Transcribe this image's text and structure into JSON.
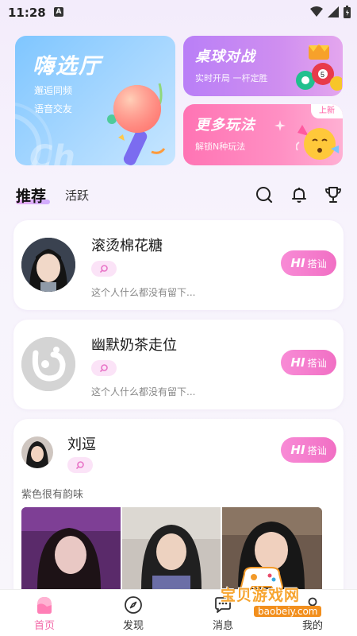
{
  "status_bar": {
    "time": "11:28",
    "notif_letter": "A"
  },
  "banners": {
    "big": {
      "title": "嗨选厅",
      "line1": "邂逅同频",
      "line2": "语音交友",
      "ghost": "Ch"
    },
    "r1": {
      "title": "桌球对战",
      "subtitle": "实时开局 一杆定胜"
    },
    "r2": {
      "title": "更多玩法",
      "subtitle": "解锁N种玩法",
      "badge": "上新"
    }
  },
  "tabs": {
    "main": "推荐",
    "second": "活跃"
  },
  "icons": {
    "search": "search-icon",
    "bell": "bell-icon",
    "trophy": "trophy-icon"
  },
  "users": [
    {
      "name": "滚烫棉花糖",
      "bio": "这个人什么都没有留下...",
      "hi": "HI",
      "hi_label": "搭讪"
    },
    {
      "name": "幽默奶茶走位",
      "bio": "这个人什么都没有留下...",
      "hi": "HI",
      "hi_label": "搭讪"
    },
    {
      "name": "刘逗",
      "bio": "紫色很有韵味",
      "hi": "HI",
      "hi_label": "搭讪"
    }
  ],
  "nav": [
    {
      "label": "首页",
      "active": true
    },
    {
      "label": "发现",
      "active": false
    },
    {
      "label": "消息",
      "active": false
    },
    {
      "label": "我的",
      "active": false
    }
  ],
  "watermark": {
    "text": "宝贝游戏网",
    "url": "baobeiy.com"
  },
  "colors": {
    "accent": "#f36aa8",
    "hi_button": "#f16fc4",
    "banner_blue": "#7fc6ff",
    "banner_purple": "#b97ff7",
    "banner_pink": "#ff74b4"
  }
}
